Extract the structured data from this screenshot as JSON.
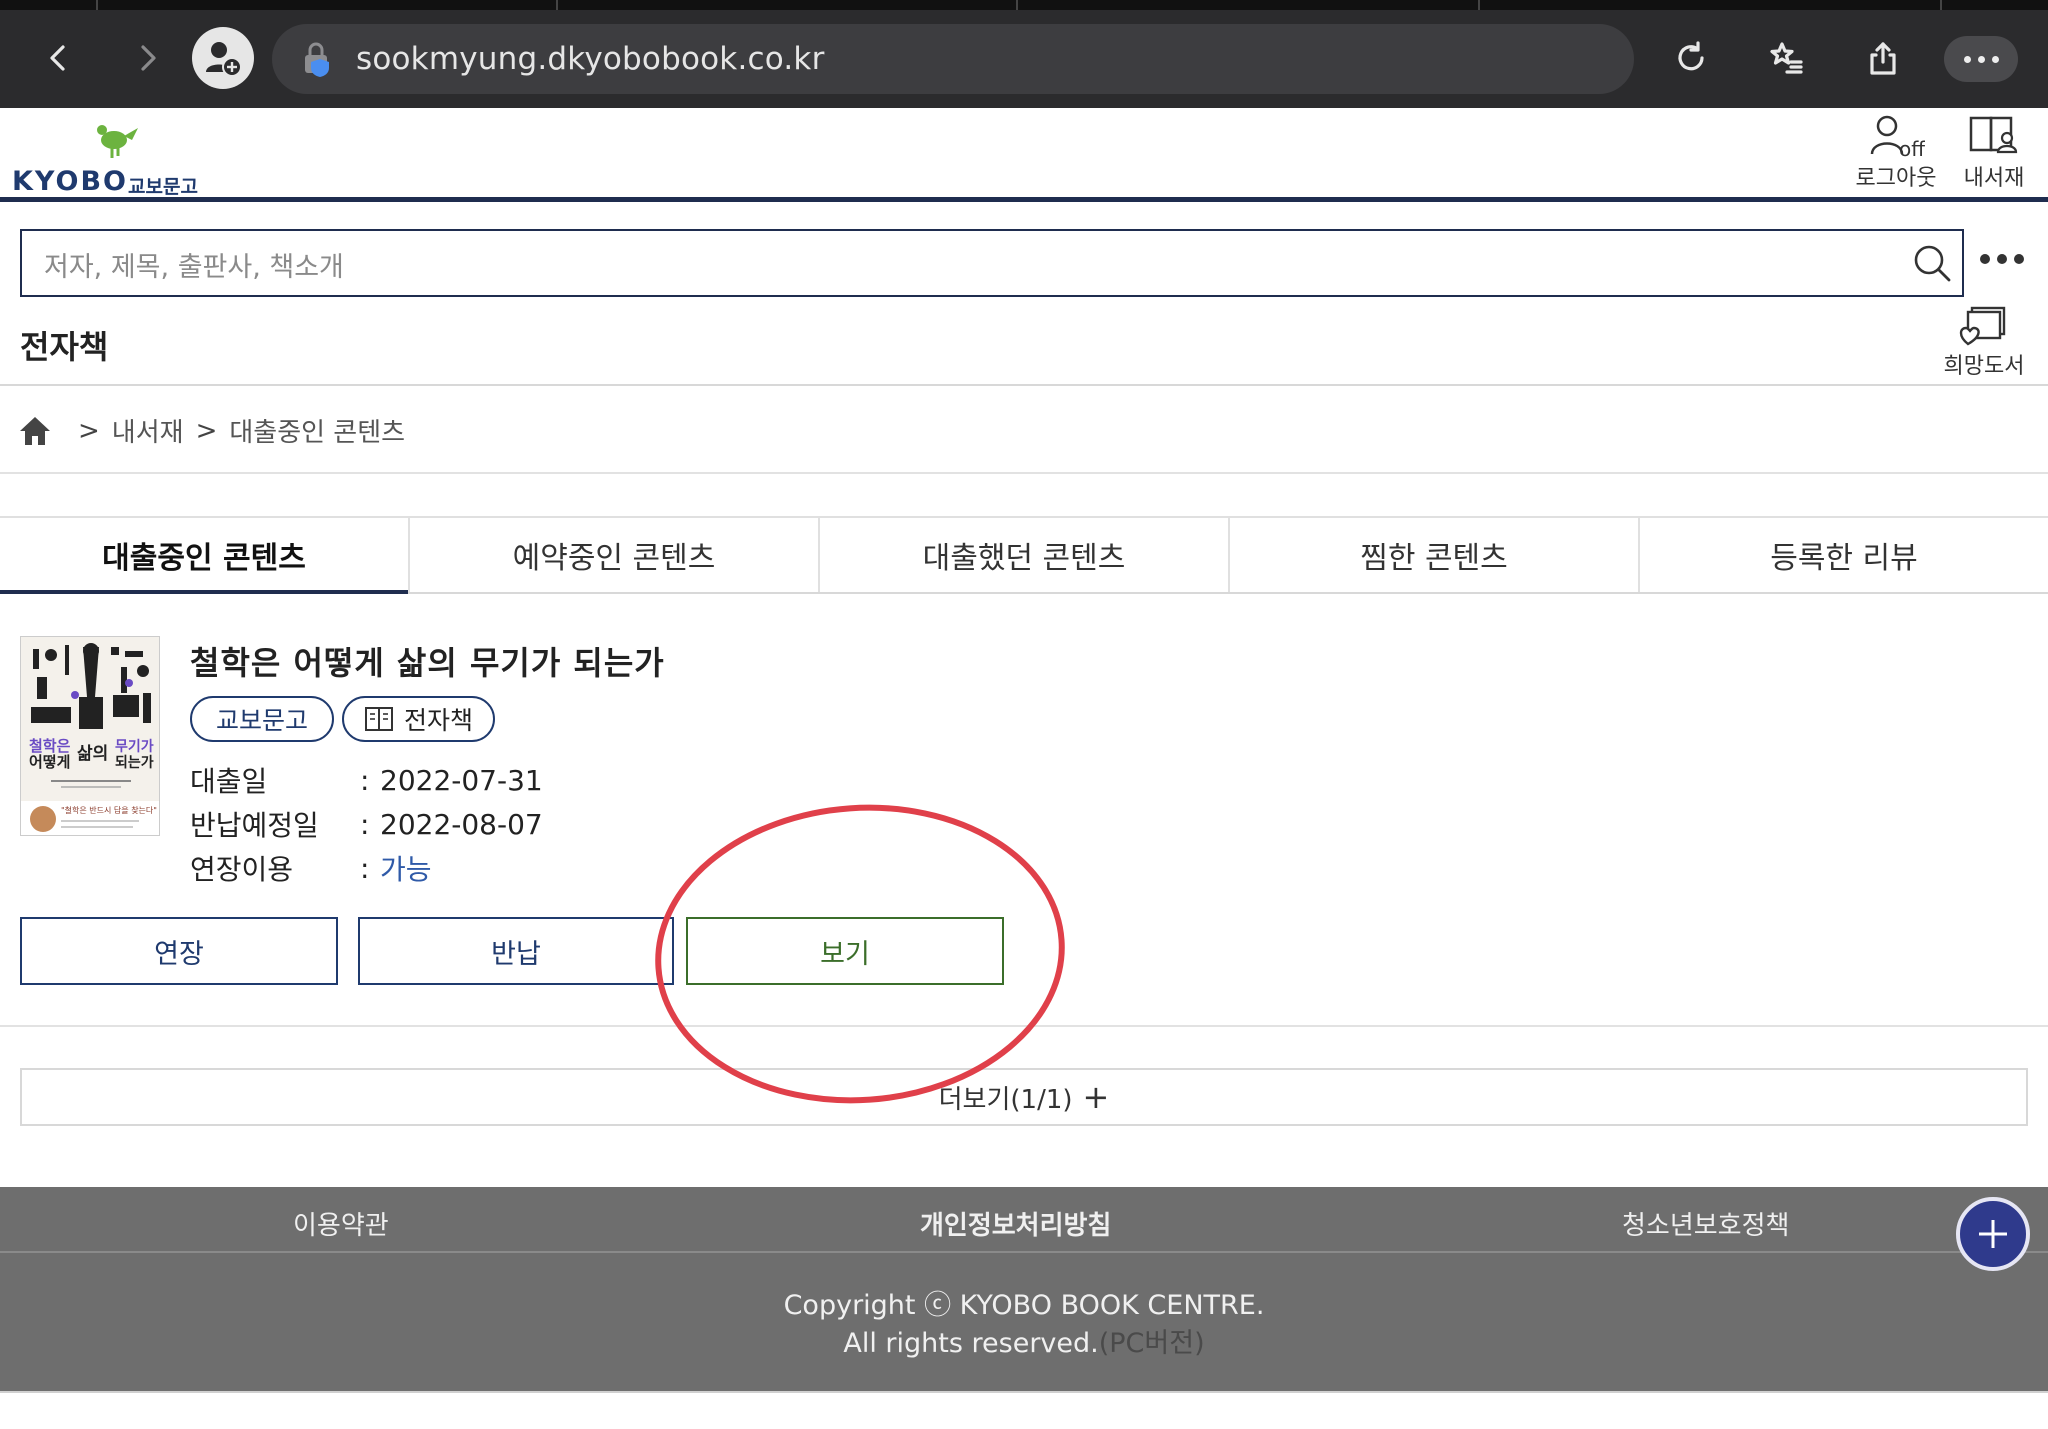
{
  "browser": {
    "url": "sookmyung.dkyobobook.co.kr"
  },
  "header": {
    "logo_text": "KYOBO",
    "logo_kr": "교보문고",
    "logout_icon_text": "off",
    "logout_label": "로그아웃",
    "bookshelf_label": "내서재"
  },
  "search": {
    "placeholder": "저자, 제목, 출판사, 책소개"
  },
  "section": {
    "title": "전자책",
    "wish_label": "희망도서"
  },
  "breadcrumb": {
    "items": [
      "내서재",
      "대출중인 콘텐츠"
    ],
    "separator": ">"
  },
  "tabs": [
    {
      "label": "대출중인 콘텐츠",
      "active": true
    },
    {
      "label": "예약중인 콘텐츠",
      "active": false
    },
    {
      "label": "대출했던 콘텐츠",
      "active": false
    },
    {
      "label": "찜한 콘텐츠",
      "active": false
    },
    {
      "label": "등록한 리뷰",
      "active": false
    }
  ],
  "item": {
    "title": "철학은 어떻게 삶의 무기가 되는가",
    "badges": [
      "교보문고",
      "전자책"
    ],
    "cover_title_a": "철학은",
    "cover_title_b": "어떻게",
    "cover_title_c": "삶의",
    "cover_title_d": "무기가",
    "cover_title_e": "되는가",
    "cover_quote": "\"철학은 반드시 답을 찾는다\"",
    "details": [
      {
        "key": "대출일",
        "value": "2022-07-31",
        "link": false
      },
      {
        "key": "반납예정일",
        "value": "2022-08-07",
        "link": false
      },
      {
        "key": "연장이용",
        "value": "가능",
        "link": true
      }
    ],
    "detail_colon": ":"
  },
  "actions": {
    "extend": "연장",
    "return": "반납",
    "view": "보기"
  },
  "more": {
    "label": "더보기(1/1)",
    "plus": "+"
  },
  "footer": {
    "terms": "이용약관",
    "privacy": "개인정보처리방침",
    "youth": "청소년보호정책",
    "copyright_line1": "Copyright ⓒ KYOBO BOOK CENTRE.",
    "copyright_line2": "All rights reserved.",
    "pc_version": "(PC버전)"
  },
  "colors": {
    "navy": "#1f2d4f",
    "view_green": "#3b6e2a",
    "annotation_red": "#e0404a",
    "footer_gray": "#6e6e6e",
    "link_blue": "#2f5aa8"
  }
}
